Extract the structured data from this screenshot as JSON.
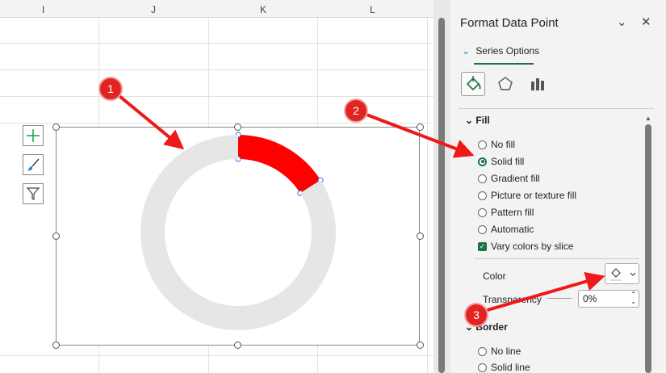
{
  "sheet": {
    "columns": [
      "I",
      "J",
      "K",
      "L"
    ]
  },
  "chart_tools": [
    "chart-elements",
    "chart-styles",
    "chart-filters"
  ],
  "chart_data": {
    "type": "pie",
    "subtype": "doughnut",
    "values": [
      16,
      84
    ],
    "colors": [
      "#ff0000",
      "#e6e6e6"
    ]
  },
  "panel": {
    "title": "Format Data Point",
    "tab": "Series Options",
    "fill": {
      "header": "Fill",
      "options": [
        "No fill",
        "Solid fill",
        "Gradient fill",
        "Picture or texture fill",
        "Pattern fill",
        "Automatic"
      ],
      "selected": 1,
      "vary_colors": "Vary colors by slice"
    },
    "color_label": "Color",
    "transparency_label": "Transparency",
    "transparency_value": "0%",
    "border": {
      "header": "Border",
      "options": [
        "No line",
        "Solid line"
      ]
    }
  },
  "annotations": [
    "1",
    "2",
    "3"
  ],
  "accent": "#1e7145"
}
